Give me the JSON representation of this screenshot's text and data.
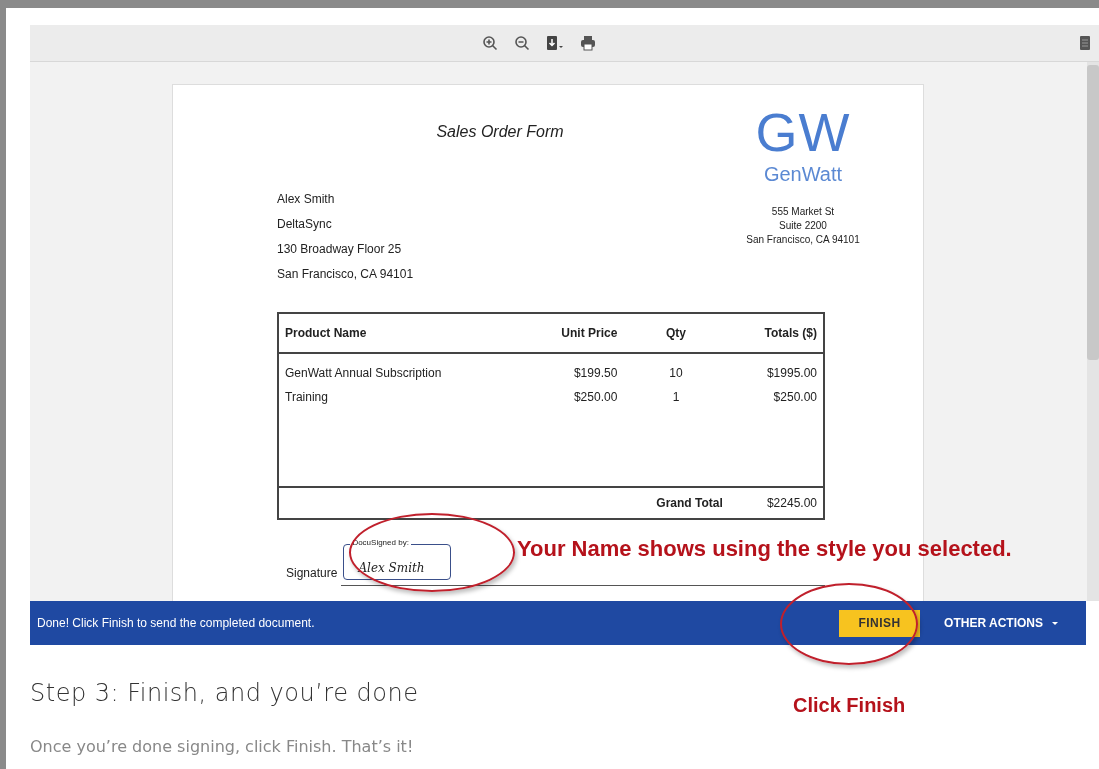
{
  "document": {
    "title": "Sales Order Form",
    "logo": {
      "initials": "GW",
      "name": "GenWatt"
    },
    "sender_address": [
      "555 Market St",
      "Suite 2200",
      "San Francisco, CA 94101"
    ],
    "recipient_address": [
      "Alex Smith",
      "DeltaSync",
      "130 Broadway Floor 25",
      "San Francisco, CA 94101"
    ],
    "table": {
      "columns": [
        "Product Name",
        "Unit Price",
        "Qty",
        "Totals ($)"
      ],
      "rows": [
        [
          "GenWatt Annual Subscription",
          "$199.50",
          "10",
          "$1995.00"
        ],
        [
          "Training",
          "$250.00",
          "1",
          "$250.00"
        ]
      ],
      "grand_total": {
        "label": "Grand Total",
        "value": "$2245.00"
      }
    },
    "signature": {
      "label": "Signature",
      "stamp_caption": "DocuSigned by:",
      "signed_name": "Alex Smith"
    }
  },
  "action_bar": {
    "message": "Done! Click Finish to send the completed document.",
    "finish_button": "FINISH",
    "other_actions": "OTHER ACTIONS"
  },
  "annotations": [
    {
      "kind": "signature",
      "text": "Your Name shows using the style you selected."
    },
    {
      "kind": "finish",
      "text": "Click Finish"
    }
  ],
  "step": {
    "heading": "Step 3: Finish, and you’re done",
    "text": "Once you’re done signing, click Finish. That’s it!"
  }
}
